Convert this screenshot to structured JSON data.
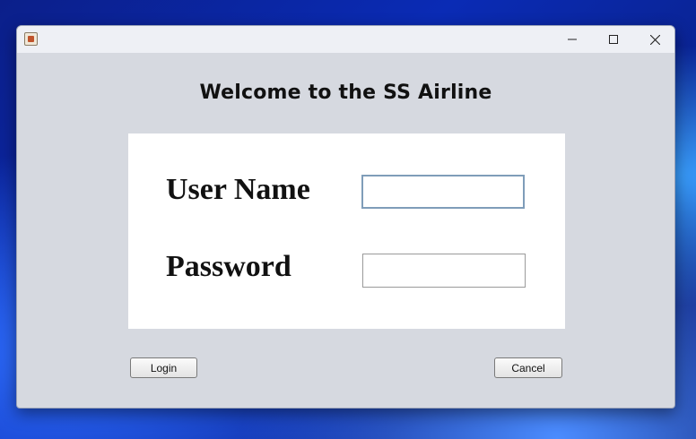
{
  "window": {
    "heading": "Welcome to the SS Airline"
  },
  "form": {
    "username_label": "User Name",
    "username_value": "",
    "password_label": "Password",
    "password_value": ""
  },
  "buttons": {
    "login_label": "Login",
    "cancel_label": "Cancel"
  },
  "titlebar": {
    "icon": "java-app-icon",
    "controls": [
      "minimize-icon",
      "maximize-icon",
      "close-icon"
    ]
  }
}
